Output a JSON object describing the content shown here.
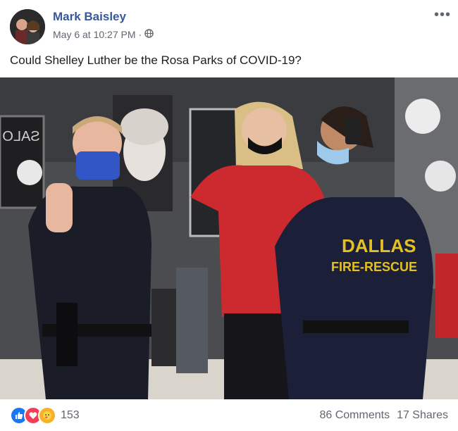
{
  "post": {
    "author": "Mark Baisley",
    "timestamp": "May 6 at 10:27 PM",
    "separator": "·",
    "privacy_icon": "globe-icon",
    "more_icon": "more-options-icon",
    "text": "Could Shelley Luther be the Rosa Parks of COVID-19?"
  },
  "photo": {
    "signs": [
      "SALO",
      "DALLAS",
      "FIRE-RESCUE"
    ]
  },
  "reactions": {
    "types": [
      "like",
      "love",
      "care"
    ],
    "count": "153"
  },
  "stats": {
    "comments": "86 Comments",
    "shares": "17 Shares"
  },
  "colors": {
    "author": "#385898",
    "muted": "#606770",
    "like": "#1877f2",
    "love": "#f33e58",
    "care": "#f7b125"
  }
}
